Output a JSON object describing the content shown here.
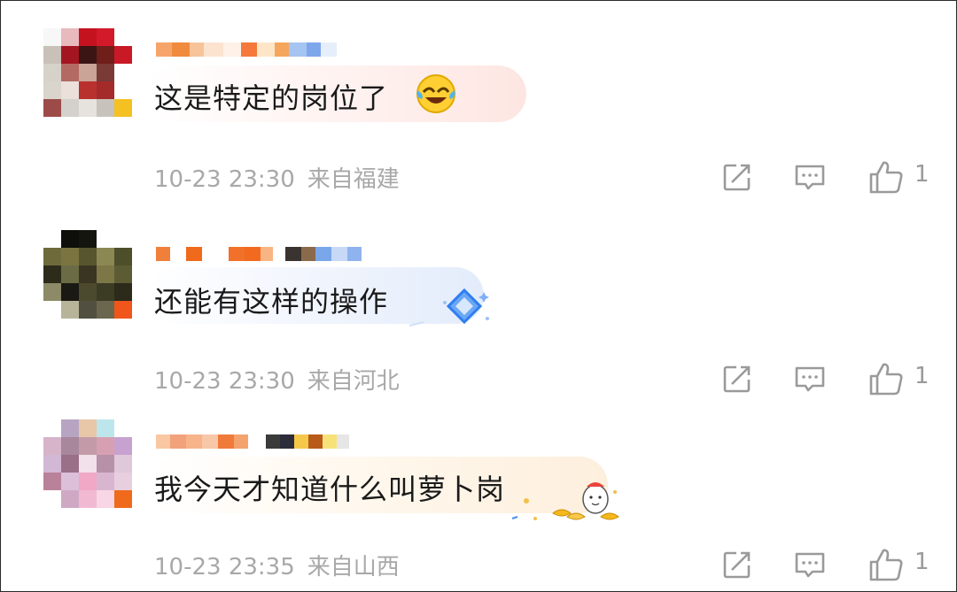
{
  "comments": [
    {
      "text": "这是特定的岗位了",
      "time": "10-23 23:30",
      "location": "来自福建",
      "likes": "1",
      "emoji": "laugh-cry-emoji",
      "accent": "#fde8e4"
    },
    {
      "text": "还能有这样的操作",
      "time": "10-23 23:30",
      "location": "来自河北",
      "likes": "1",
      "emoji": "diamond-sticker",
      "accent": "#e6eefc"
    },
    {
      "text": "我今天才知道什么叫萝卜岗",
      "time": "10-23 23:35",
      "location": "来自山西",
      "likes": "1",
      "emoji": "gold-ingot-sticker",
      "accent": "#fdf1e1"
    }
  ],
  "icons": {
    "share": "share-icon",
    "reply": "comment-icon",
    "like": "thumbs-up-icon"
  },
  "colors": {
    "meta": "#a8a8a8",
    "icon": "#9a9a9a",
    "text": "#1a1a1a"
  }
}
